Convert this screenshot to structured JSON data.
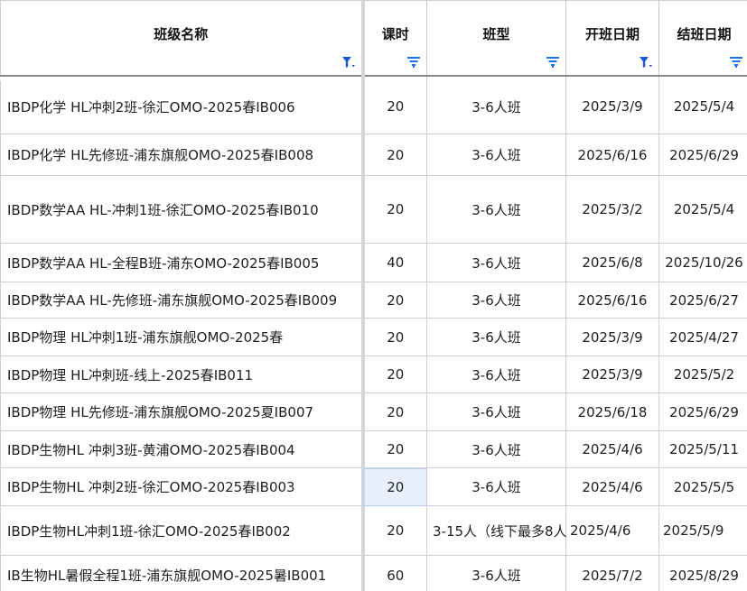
{
  "headers": [
    {
      "label": "班级名称",
      "filter": "active"
    },
    {
      "label": "课时",
      "filter": "inactive"
    },
    {
      "label": "班型",
      "filter": "inactive"
    },
    {
      "label": "开班日期",
      "filter": "active"
    },
    {
      "label": "结班日期",
      "filter": "inactive"
    }
  ],
  "rows": [
    {
      "name": "IBDP化学 HL冲刺2班-徐汇OMO-2025春IB006",
      "hours": "20",
      "type": "3-6人班",
      "start": "2025/3/9",
      "end": "2025/5/4"
    },
    {
      "name": "IBDP化学 HL先修班-浦东旗舰OMO-2025春IB008",
      "hours": "20",
      "type": "3-6人班",
      "start": "2025/6/16",
      "end": "2025/6/29"
    },
    {
      "name": "IBDP数学AA HL-冲刺1班-徐汇OMO-2025春IB010",
      "hours": "20",
      "type": "3-6人班",
      "start": "2025/3/2",
      "end": "2025/5/4"
    },
    {
      "name": "IBDP数学AA HL-全程B班-浦东OMO-2025春IB005",
      "hours": "40",
      "type": "3-6人班",
      "start": "2025/6/8",
      "end": "2025/10/26"
    },
    {
      "name": "IBDP数学AA HL-先修班-浦东旗舰OMO-2025春IB009",
      "hours": "20",
      "type": "3-6人班",
      "start": "2025/6/16",
      "end": "2025/6/27"
    },
    {
      "name": "IBDP物理 HL冲刺1班-浦东旗舰OMO-2025春",
      "hours": "20",
      "type": "3-6人班",
      "start": "2025/3/9",
      "end": "2025/4/27"
    },
    {
      "name": "IBDP物理 HL冲刺班-线上-2025春IB011",
      "hours": "20",
      "type": "3-6人班",
      "start": "2025/3/9",
      "end": "2025/5/2"
    },
    {
      "name": "IBDP物理 HL先修班-浦东旗舰OMO-2025夏IB007",
      "hours": "20",
      "type": "3-6人班",
      "start": "2025/6/18",
      "end": "2025/6/29"
    },
    {
      "name": "IBDP生物HL 冲刺3班-黄浦OMO-2025春IB004",
      "hours": "20",
      "type": "3-6人班",
      "start": "2025/4/6",
      "end": "2025/5/11"
    },
    {
      "name": "IBDP生物HL 冲刺2班-徐汇OMO-2025春IB003",
      "hours": "20",
      "type": "3-6人班",
      "start": "2025/4/6",
      "end": "2025/5/5"
    },
    {
      "name": "IBDP生物HL冲刺1班-徐汇OMO-2025春IB002",
      "hours": "20",
      "type": "3-15人（线下最多8人",
      "start": "2025/4/6",
      "end": "2025/5/9"
    },
    {
      "name": "IB生物HL暑假全程1班-浦东旗舰OMO-2025暑IB001",
      "hours": "60",
      "type": "3-6人班",
      "start": "2025/7/2",
      "end": "2025/8/29"
    }
  ],
  "selected_row": 9,
  "colors": {
    "filter_active": "#1a56d6",
    "filter_inactive": "#1a73e8",
    "selection": "#e7f0fd"
  }
}
